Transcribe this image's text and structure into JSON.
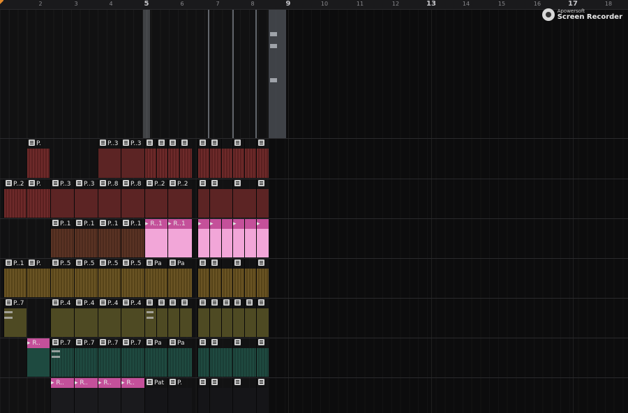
{
  "ruler": {
    "ticks": [
      "2",
      "3",
      "4",
      "5",
      "6",
      "7",
      "8",
      "9",
      "10",
      "11",
      "12",
      "13",
      "14",
      "15",
      "16",
      "17",
      "18"
    ],
    "major": [
      "5",
      "9",
      "13",
      "17"
    ]
  },
  "watermark": {
    "small": "Apowersoft",
    "big": "Screen Recorder"
  },
  "clip_labels": {
    "p": "P..",
    "p3": "P..3",
    "p2": "P..2",
    "p8": "P..8",
    "p1": "P..1",
    "p5": "P..5",
    "p7": "P..7",
    "p4": "P..4",
    "pa": "Pa",
    "pat": "Pat",
    "r1": "R..1",
    "r": "R..",
    "pdot": "P.",
    "padots": "Pa.."
  },
  "colors": {
    "playlist_bg": "#111112",
    "marker": "#e38a2b",
    "pink_clip": "#f2a6d8"
  }
}
